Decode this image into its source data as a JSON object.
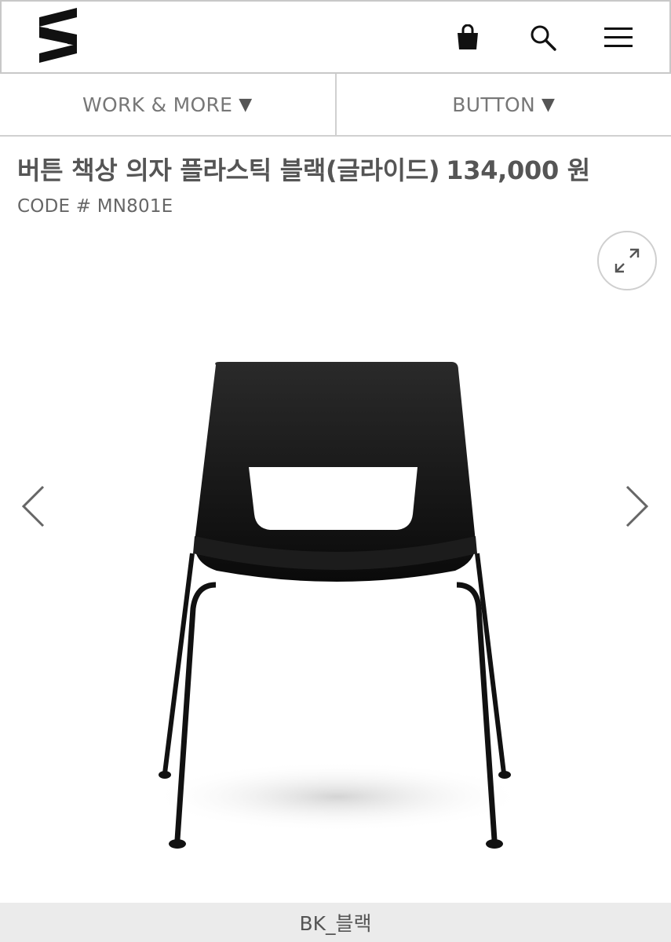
{
  "header": {
    "logo_icon": "brand-s-logo",
    "cart_icon": "shopping-bag-icon",
    "search_icon": "search-icon",
    "menu_icon": "hamburger-menu-icon"
  },
  "categories": [
    {
      "label": "WORK & MORE",
      "arrow": "▼"
    },
    {
      "label": "BUTTON",
      "arrow": "▼"
    }
  ],
  "product": {
    "name": "버튼 책상 의자 플라스틱 블랙(글라이드)",
    "price": "134,000 원",
    "code": "CODE # MN801E"
  },
  "gallery": {
    "zoom_icon": "expand-icon",
    "prev_icon": "chevron-left-icon",
    "next_icon": "chevron-right-icon",
    "caption": "BK_블랙"
  },
  "colors": {
    "text": "#555555",
    "border": "#d0d0d0",
    "caption_bg": "#ebebeb",
    "chair": "#111111"
  }
}
